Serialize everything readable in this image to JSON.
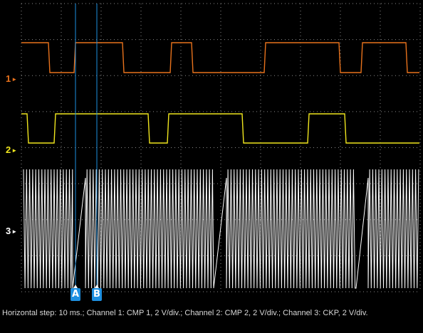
{
  "colors": {
    "background": "#000000",
    "grid": "#8a8a8a",
    "channel_1": "#e8721c",
    "channel_2": "#f0e61e",
    "channel_3": "#ffffff",
    "cursor": "#1d8fe0"
  },
  "channels": [
    {
      "label": "1",
      "marker_icon": "right-arrow-icon",
      "color": "#e8721c"
    },
    {
      "label": "2",
      "marker_icon": "right-arrow-icon",
      "color": "#f0e61e"
    },
    {
      "label": "3",
      "marker_icon": "right-arrow-icon",
      "color": "#ffffff"
    }
  ],
  "cursors": [
    {
      "label": "A"
    },
    {
      "label": "B"
    }
  ],
  "caption": "Horizontal step: 10 ms.; Channel 1: CMP 1, 2 V/div.; Channel 2: CMP 2, 2 V/div.; Channel 3: CKP, 2 V/div."
}
